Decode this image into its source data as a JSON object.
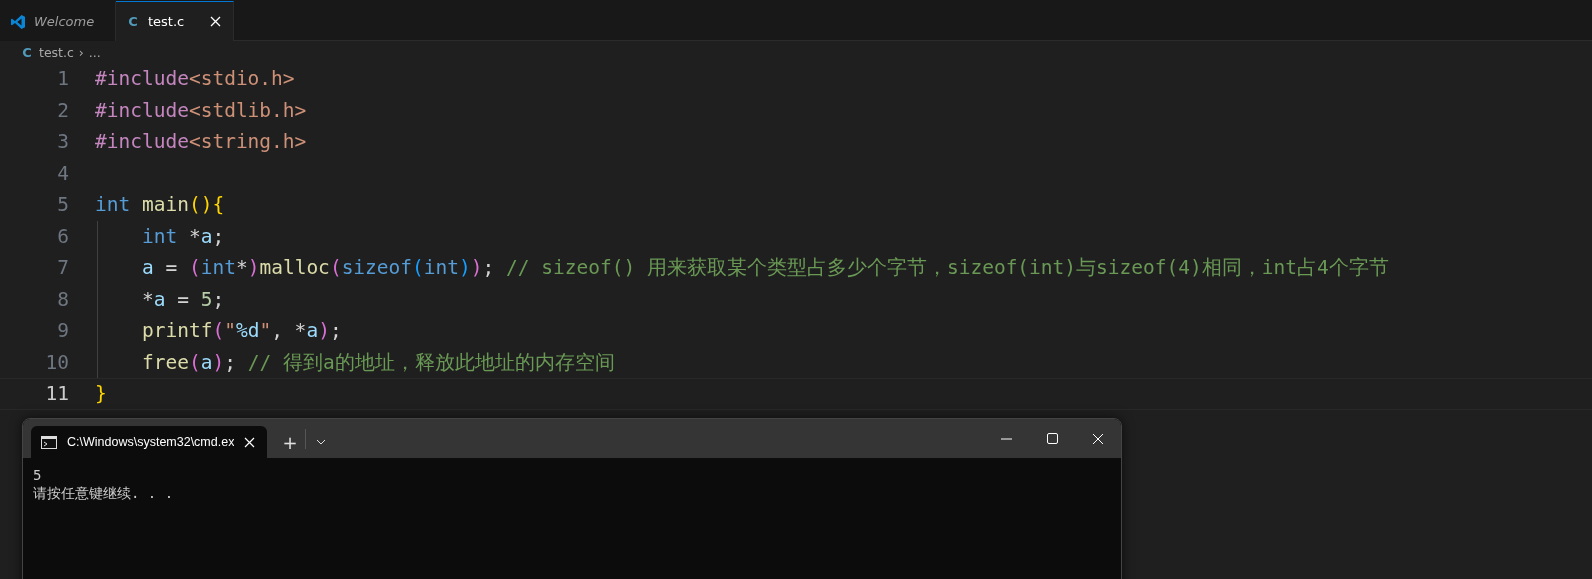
{
  "tabs": [
    {
      "label": "Welcome",
      "kind": "welcome",
      "selected": false
    },
    {
      "label": "test.c",
      "kind": "file",
      "glyph": "C",
      "selected": true
    }
  ],
  "breadcrumb": {
    "glyph": "C",
    "file": "test.c",
    "separator": "›",
    "rest": "..."
  },
  "code": {
    "lines": [
      {
        "number": "1",
        "tokens": [
          {
            "kind": "include",
            "text": "#include"
          },
          {
            "kind": "header",
            "text": "<stdio.h>"
          }
        ]
      },
      {
        "number": "2",
        "tokens": [
          {
            "kind": "include",
            "text": "#include"
          },
          {
            "kind": "header",
            "text": "<stdlib.h>"
          }
        ]
      },
      {
        "number": "3",
        "tokens": [
          {
            "kind": "include",
            "text": "#include"
          },
          {
            "kind": "header",
            "text": "<string.h>"
          }
        ]
      },
      {
        "number": "4"
      },
      {
        "number": "5",
        "tokens": [
          {
            "kind": "keyword",
            "text": "int"
          },
          {
            "kind": "function",
            "text": " main"
          },
          {
            "kind": "bracket1",
            "text": "(){"
          }
        ]
      },
      {
        "number": "6",
        "indent": true,
        "tokens": [
          {
            "kind": "keyword",
            "text": "int"
          },
          {
            "kind": "plain",
            "text": " *"
          },
          {
            "kind": "variable",
            "text": "a"
          },
          {
            "kind": "plain",
            "text": ";"
          }
        ]
      },
      {
        "number": "7",
        "indent": true,
        "tokens": [
          {
            "kind": "variable",
            "text": "a"
          },
          {
            "kind": "plain",
            "text": " = "
          },
          {
            "kind": "bracket2",
            "text": "("
          },
          {
            "kind": "keyword",
            "text": "int"
          },
          {
            "kind": "plain",
            "text": "*"
          },
          {
            "kind": "bracket2",
            "text": ")"
          },
          {
            "kind": "function",
            "text": "malloc"
          },
          {
            "kind": "bracket2",
            "text": "("
          },
          {
            "kind": "keyword",
            "text": "sizeof"
          },
          {
            "kind": "bracket3",
            "text": "("
          },
          {
            "kind": "keyword",
            "text": "int"
          },
          {
            "kind": "bracket3",
            "text": ")"
          },
          {
            "kind": "bracket2",
            "text": ")"
          },
          {
            "kind": "plain",
            "text": "; "
          },
          {
            "kind": "comment",
            "text": "// sizeof() 用来获取某个类型占多少个字节，sizeof(int)与sizeof(4)相同，int占4个字节"
          }
        ]
      },
      {
        "number": "8",
        "indent": true,
        "tokens": [
          {
            "kind": "plain",
            "text": "*"
          },
          {
            "kind": "variable",
            "text": "a"
          },
          {
            "kind": "plain",
            "text": " = "
          },
          {
            "kind": "number",
            "text": "5"
          },
          {
            "kind": "plain",
            "text": ";"
          }
        ]
      },
      {
        "number": "9",
        "indent": true,
        "tokens": [
          {
            "kind": "function",
            "text": "printf"
          },
          {
            "kind": "bracket2",
            "text": "("
          },
          {
            "kind": "string",
            "text": "\""
          },
          {
            "kind": "variable",
            "text": "%d"
          },
          {
            "kind": "string",
            "text": "\""
          },
          {
            "kind": "plain",
            "text": ", *"
          },
          {
            "kind": "variable",
            "text": "a"
          },
          {
            "kind": "bracket2",
            "text": ")"
          },
          {
            "kind": "plain",
            "text": ";"
          }
        ]
      },
      {
        "number": "10",
        "indent": true,
        "tokens": [
          {
            "kind": "function",
            "text": "free"
          },
          {
            "kind": "bracket2",
            "text": "("
          },
          {
            "kind": "variable",
            "text": "a"
          },
          {
            "kind": "bracket2",
            "text": ")"
          },
          {
            "kind": "plain",
            "text": "; "
          },
          {
            "kind": "comment",
            "text": "// 得到a的地址，释放此地址的内存空间"
          }
        ]
      },
      {
        "number": "11",
        "current": true,
        "tokens": [
          {
            "kind": "bracket1",
            "text": "}"
          }
        ]
      }
    ]
  },
  "terminal": {
    "tab_title": "C:\\Windows\\system32\\cmd.ex",
    "new_tab": "+",
    "output": [
      "5",
      "请按任意键继续. . ."
    ]
  }
}
